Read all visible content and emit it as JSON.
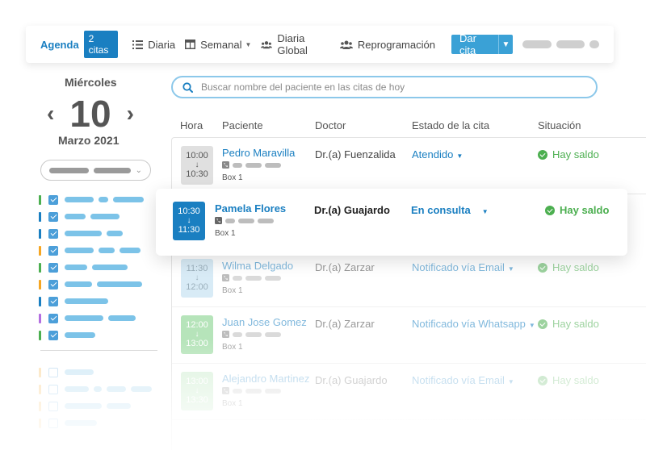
{
  "toolbar": {
    "agenda_label": "Agenda",
    "count_badge": "2 citas",
    "views": [
      {
        "label": "Diaria",
        "icon": "list-icon"
      },
      {
        "label": "Semanal",
        "icon": "calendar-icon"
      },
      {
        "label": "Diaria Global",
        "icon": "users-icon"
      },
      {
        "label": "Reprogramación",
        "icon": "users-icon"
      }
    ],
    "dar_cita_label": "Dar cita"
  },
  "calendar": {
    "weekday": "Miércoles",
    "day": "10",
    "month_year": "Marzo 2021"
  },
  "search": {
    "placeholder": "Buscar nombre del paciente en las citas de hoy"
  },
  "table": {
    "headers": {
      "hora": "Hora",
      "paciente": "Paciente",
      "doctor": "Doctor",
      "estado": "Estado de la cita",
      "situacion": "Situación"
    },
    "rows": [
      {
        "start": "10:00",
        "end": "10:30",
        "arrow": "↓",
        "patient": "Pedro Maravilla",
        "box": "Box 1",
        "doctor": "Dr.(a) Fuenzalida",
        "status": "Atendido",
        "situacion": "Hay saldo",
        "time_color": "#e0e0e0",
        "time_text": "#555555"
      },
      {
        "start": "11:30",
        "end": "12:00",
        "arrow": "↓",
        "patient": "Wilma Delgado",
        "box": "Box 1",
        "doctor": "Dr.(a) Zarzar",
        "status": "Notificado vía Email",
        "situacion": "Hay saldo",
        "time_color": "#b9dcef",
        "time_text": "#4a6f85"
      },
      {
        "start": "12:00",
        "end": "13:00",
        "arrow": "↓",
        "patient": "Juan Jose Gomez",
        "box": "Box 1",
        "doctor": "Dr.(a) Zarzar",
        "status": "Notificado vía Whatsapp",
        "situacion": "Hay saldo",
        "time_color": "#7ccf83",
        "time_text": "#ffffff"
      },
      {
        "start": "13:00",
        "end": "13:30",
        "arrow": "↓",
        "patient": "Alejandro Martinez",
        "box": "Box 1",
        "doctor": "Dr.(a) Guajardo",
        "status": "Notificado vía Email",
        "situacion": "Hay saldo",
        "time_color": "#a6dfaa",
        "time_text": "#ffffff"
      }
    ],
    "highlight": {
      "start": "10:30",
      "end": "11:30",
      "arrow": "↓",
      "patient": "Pamela Flores",
      "box": "Box 1",
      "doctor": "Dr.(a) Guajardo",
      "status": "En consulta",
      "situacion": "Hay saldo",
      "time_color": "#1a7fc1",
      "time_text": "#ffffff"
    }
  },
  "colors": {
    "accent": "#1a7fc1",
    "button": "#3aa1d6",
    "success": "#4caf50",
    "filter_stripes": [
      "#4caf50",
      "#1a7fc1",
      "#1a7fc1",
      "#f5a623",
      "#4caf50",
      "#f5a623",
      "#1a7fc1",
      "#b36ee0",
      "#4caf50"
    ]
  }
}
